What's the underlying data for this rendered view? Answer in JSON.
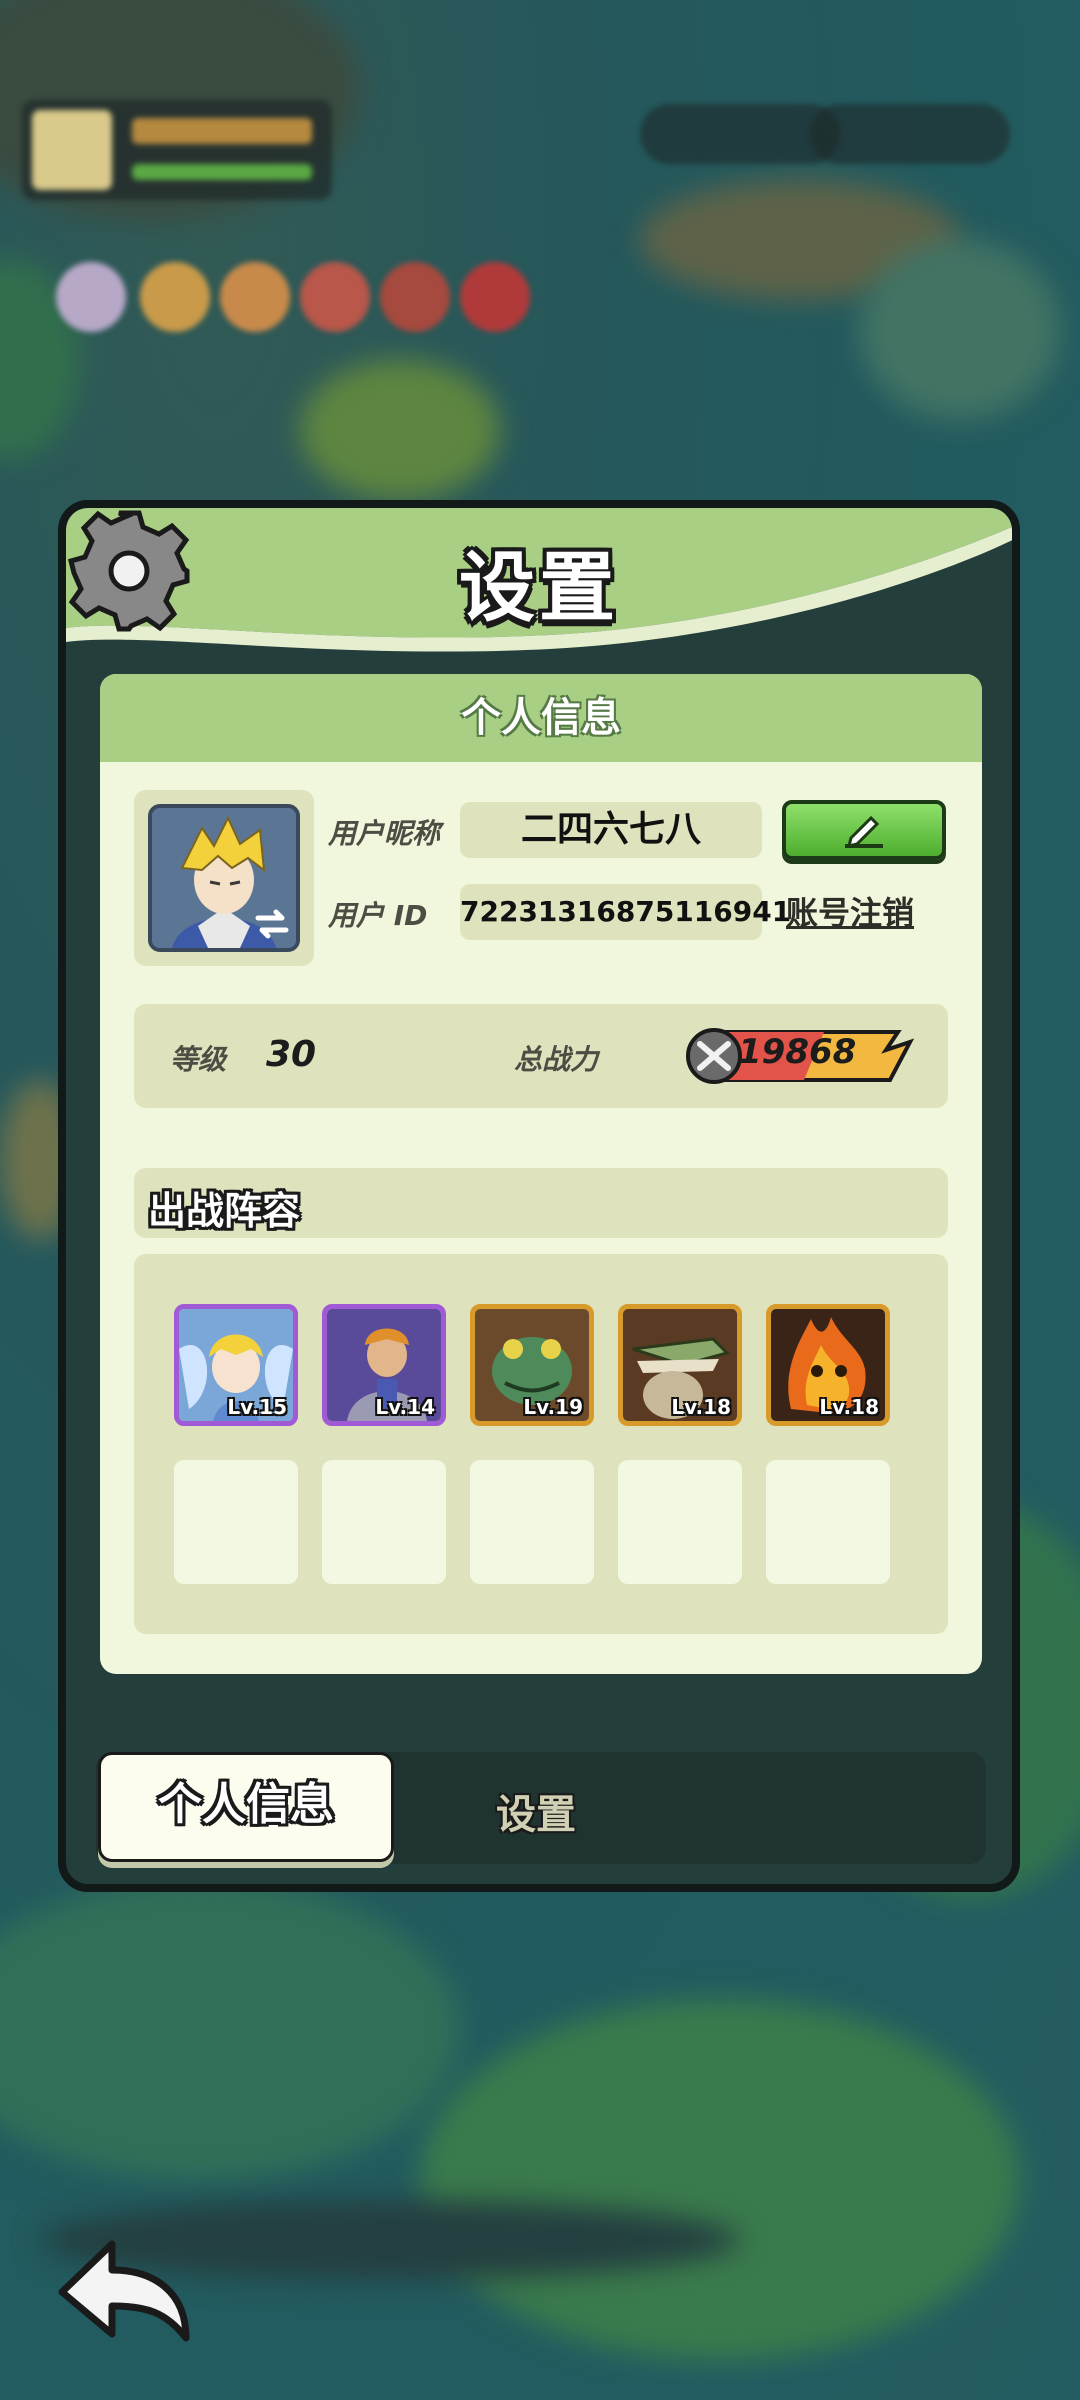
{
  "panel": {
    "title": "设置",
    "section_title": "个人信息"
  },
  "profile": {
    "nickname_label": "用户昵称",
    "nickname": "二四六七八",
    "id_label": "用户 ID",
    "user_id": "72231316875116941",
    "account_link": "账号注销"
  },
  "stats": {
    "level_label": "等级",
    "level": "30",
    "power_label": "总战力",
    "power": "19868"
  },
  "lineup": {
    "title": "出战阵容",
    "heroes": [
      {
        "level": "Lv.15",
        "rarity": "purple",
        "icon": "fairy-hero-icon"
      },
      {
        "level": "Lv.14",
        "rarity": "purple",
        "icon": "knight-hero-icon"
      },
      {
        "level": "Lv.19",
        "rarity": "orange",
        "icon": "frog-hero-icon"
      },
      {
        "level": "Lv.18",
        "rarity": "orange",
        "icon": "crocodile-hero-icon"
      },
      {
        "level": "Lv.18",
        "rarity": "orange",
        "icon": "fire-hero-icon"
      }
    ],
    "empty_slots": 5
  },
  "tabs": {
    "active": "个人信息",
    "inactive": "设置"
  },
  "colors": {
    "header_green": "#a8cf84",
    "content_bg": "#f1f7dc",
    "edit_button": "#5cbf3a",
    "purple_frame": "#a05ad6",
    "orange_frame": "#d99a2c"
  }
}
